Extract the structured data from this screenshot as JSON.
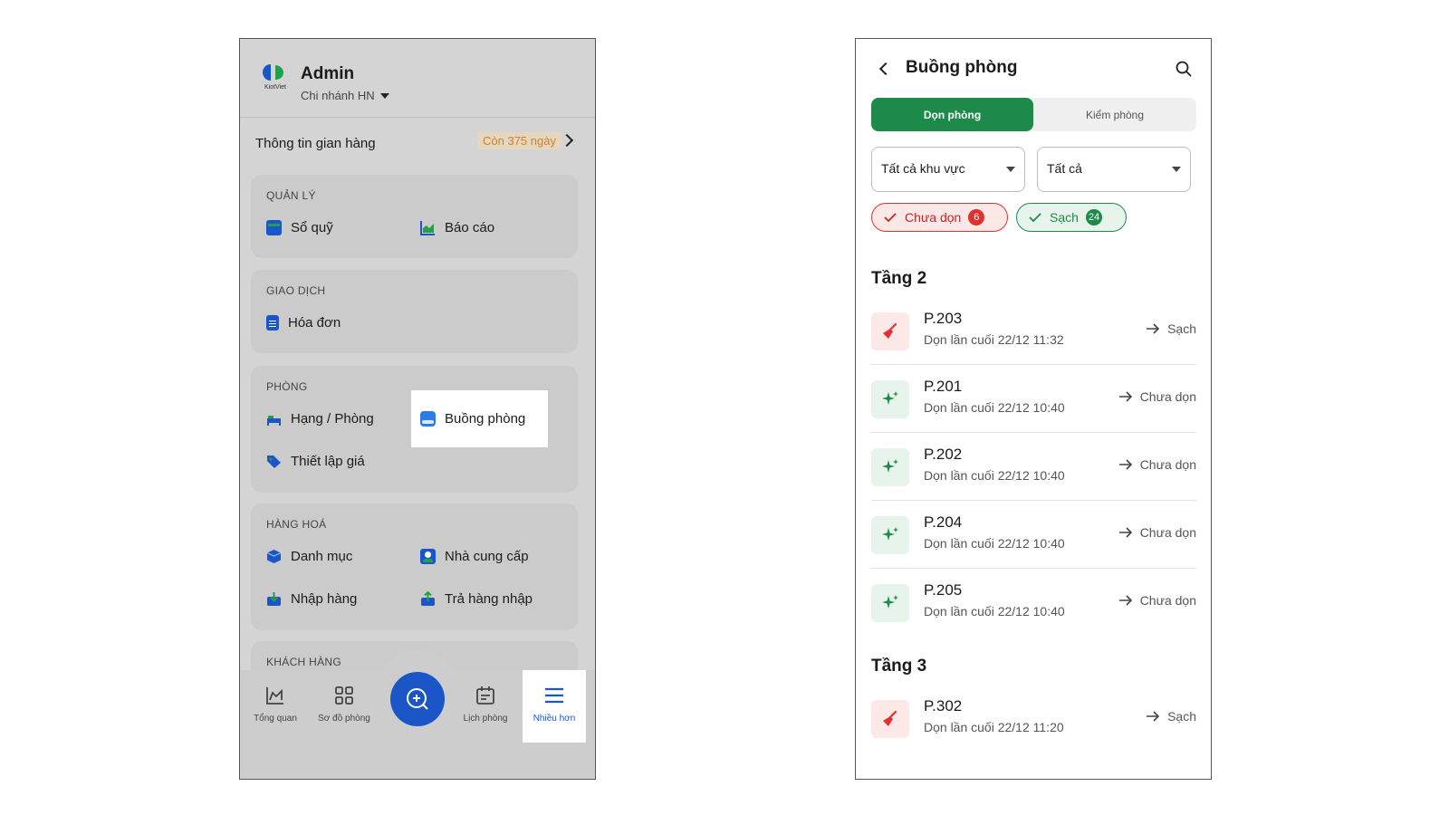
{
  "left_screen": {
    "header": {
      "logo_text": "KiotViet",
      "user_name": "Admin",
      "branch": "Chi nhánh HN"
    },
    "store_info": {
      "label": "Thông tin gian hàng",
      "days_left": "Còn 375 ngày"
    },
    "sections": {
      "management": {
        "title": "QUẢN LÝ",
        "items": [
          "Sổ quỹ",
          "Báo cáo"
        ]
      },
      "transactions": {
        "title": "GIAO DỊCH",
        "items": [
          "Hóa đơn"
        ]
      },
      "rooms": {
        "title": "PHÒNG",
        "items": [
          "Hạng / Phòng",
          "Buồng phòng",
          "Thiết lập giá"
        ]
      },
      "goods": {
        "title": "HÀNG HOÁ",
        "items": [
          "Danh mục",
          "Nhà cung cấp",
          "Nhập hàng",
          "Trả hàng nhập"
        ]
      },
      "customers": {
        "title": "KHÁCH HÀNG"
      }
    },
    "bottom_nav": {
      "items": [
        "Tổng quan",
        "Sơ đồ phòng",
        "Lịch phòng",
        "Nhiều hơn"
      ],
      "active": "Nhiều hơn"
    },
    "colors": {
      "accent": "#1a56c8",
      "overlay": "#d4d4d4",
      "days_badge_text": "#c9842c"
    }
  },
  "right_screen": {
    "title": "Buồng phòng",
    "tabs": [
      "Dọn phòng",
      "Kiểm phòng"
    ],
    "active_tab": "Dọn phòng",
    "filters": {
      "area": "Tất cả khu vực",
      "status": "Tất cả"
    },
    "chips": [
      {
        "label": "Chưa dọn",
        "count": "6"
      },
      {
        "label": "Sạch",
        "count": "24"
      }
    ],
    "floors": [
      {
        "name": "Tầng 2",
        "rooms": [
          {
            "name": "P.203",
            "last_cleaned": "Dọn lần cuối 22/12 11:32",
            "action": "Sạch",
            "state": "dirty"
          },
          {
            "name": "P.201",
            "last_cleaned": "Dọn lần cuối 22/12 10:40",
            "action": "Chưa dọn",
            "state": "clean"
          },
          {
            "name": "P.202",
            "last_cleaned": "Dọn lần cuối 22/12 10:40",
            "action": "Chưa dọn",
            "state": "clean"
          },
          {
            "name": "P.204",
            "last_cleaned": "Dọn lần cuối 22/12 10:40",
            "action": "Chưa dọn",
            "state": "clean"
          },
          {
            "name": "P.205",
            "last_cleaned": "Dọn lần cuối 22/12 10:40",
            "action": "Chưa dọn",
            "state": "clean"
          }
        ]
      },
      {
        "name": "Tầng 3",
        "rooms": [
          {
            "name": "P.302",
            "last_cleaned": "Dọn lần cuối 22/12 11:20",
            "action": "Sạch",
            "state": "dirty"
          }
        ]
      }
    ],
    "colors": {
      "primary_green": "#1e8a4a",
      "dirty_red": "#e03131",
      "dirty_bg": "#fde8e8",
      "clean_bg": "#e6f4ec"
    }
  }
}
